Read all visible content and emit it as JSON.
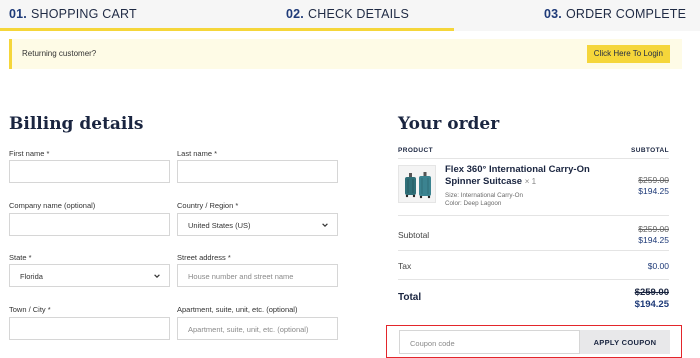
{
  "steps": [
    {
      "num": "01.",
      "label": "SHOPPING CART"
    },
    {
      "num": "02.",
      "label": "CHECK DETAILS"
    },
    {
      "num": "03.",
      "label": "ORDER COMPLETE"
    }
  ],
  "notice": {
    "text": "Returning customer?",
    "button": "Click Here To Login"
  },
  "billing": {
    "title": "Billing details",
    "first_name": {
      "label": "First name *"
    },
    "last_name": {
      "label": "Last name *"
    },
    "company": {
      "label": "Company name (optional)"
    },
    "country": {
      "label": "Country / Region *",
      "value": "United States (US)"
    },
    "state": {
      "label": "State *",
      "value": "Florida"
    },
    "street": {
      "label": "Street address *",
      "placeholder": "House number and street name"
    },
    "city": {
      "label": "Town / City *"
    },
    "apartment": {
      "label": "Apartment, suite, unit, etc. (optional)",
      "placeholder": "Apartment, suite, unit, etc. (optional)"
    }
  },
  "order": {
    "title": "Your order",
    "col_product": "PRODUCT",
    "col_subtotal": "SUBTOTAL",
    "item": {
      "name": "Flex 360° International Carry-On Spinner Suitcase",
      "qty": "× 1",
      "size": "Size: International Carry-On",
      "color": "Color: Deep Lagoon",
      "price_old": "$259.00",
      "price_new": "$194.25"
    },
    "subtotal": {
      "label": "Subtotal",
      "old": "$259.00",
      "new": "$194.25"
    },
    "tax": {
      "label": "Tax",
      "value": "$0.00"
    },
    "total": {
      "label": "Total",
      "old": "$259.00",
      "new": "$194.25"
    }
  },
  "coupon": {
    "placeholder": "Coupon code",
    "button": "APPLY COUPON"
  },
  "colors": {
    "accent_yellow": "#f5d63a",
    "navy": "#1e3a78",
    "highlight_red": "#e3262b"
  }
}
